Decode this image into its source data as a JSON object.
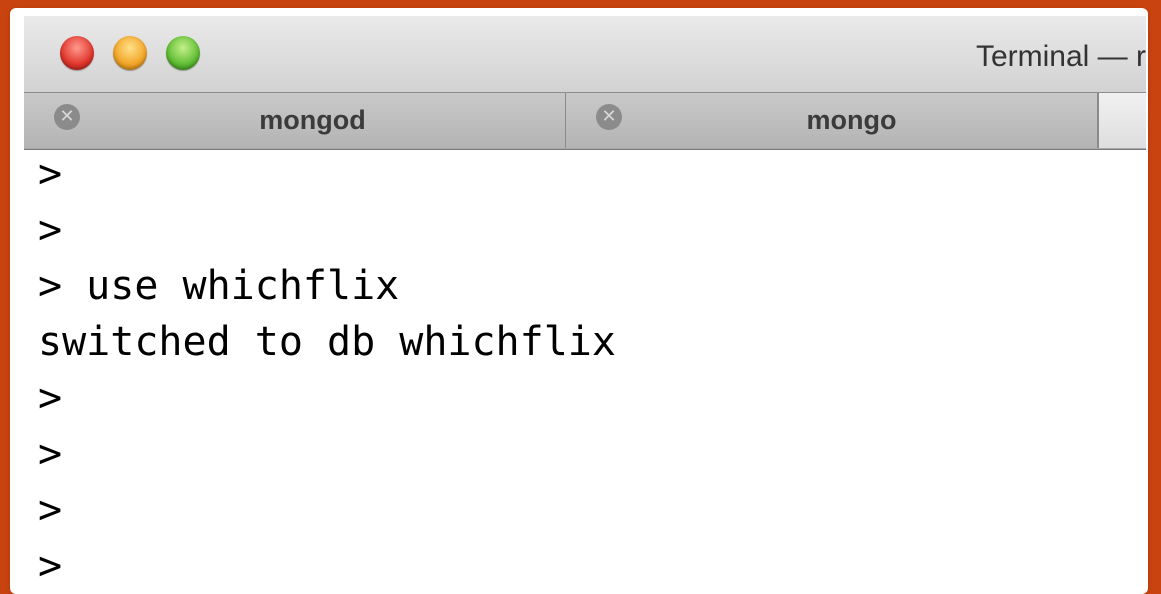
{
  "window": {
    "title": "Terminal — r"
  },
  "tabs": [
    {
      "label": "mongod",
      "close_glyph": "✕"
    },
    {
      "label": "mongo",
      "close_glyph": "✕"
    }
  ],
  "console": {
    "lines": [
      ">",
      ">",
      "> use whichflix",
      "switched to db whichflix",
      ">",
      ">",
      ">",
      ">"
    ]
  },
  "colors": {
    "background": "#c8430f",
    "close_red": "#e0352b",
    "minimize_yellow": "#f2a526",
    "zoom_green": "#5fbd33"
  }
}
